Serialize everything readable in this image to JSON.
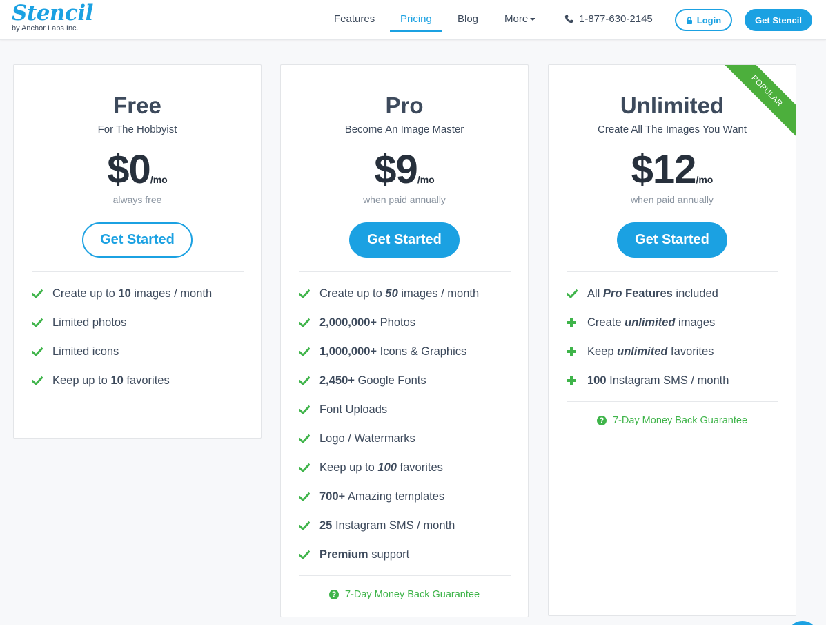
{
  "header": {
    "logo_word": "Stencil",
    "logo_sub": "by Anchor Labs Inc.",
    "nav": [
      {
        "label": "Features"
      },
      {
        "label": "Pricing",
        "active": true
      },
      {
        "label": "Blog"
      },
      {
        "label": "More"
      }
    ],
    "phone": "1-877-630-2145",
    "login_label": "Login",
    "cta_label": "Get Stencil"
  },
  "colors": {
    "accent": "#1ba1e2",
    "check": "#3fb44a",
    "ribbon": "#4caf3c",
    "text": "#3d4a5c"
  },
  "plans": [
    {
      "name": "Free",
      "tagline": "For The Hobbyist",
      "price": "$0",
      "period": "/mo",
      "note": "always free",
      "button": "Get Started",
      "features": [
        {
          "icon": "check-icon",
          "parts": [
            "Create up to ",
            "10",
            " images / month"
          ]
        },
        {
          "icon": "check-icon",
          "parts": [
            "Limited photos"
          ]
        },
        {
          "icon": "check-icon",
          "parts": [
            "Limited icons"
          ]
        },
        {
          "icon": "check-icon",
          "parts": [
            "Keep up to ",
            "10",
            " favorites"
          ]
        }
      ]
    },
    {
      "name": "Pro",
      "tagline": "Become An Image Master",
      "price": "$9",
      "period": "/mo",
      "note": "when paid annually",
      "button": "Get Started",
      "features": [
        {
          "icon": "check-icon",
          "parts": [
            "Create up to ",
            "50",
            " images / month"
          ]
        },
        {
          "icon": "check-icon",
          "parts": [
            "2,000,000+",
            " Photos"
          ]
        },
        {
          "icon": "check-icon",
          "parts": [
            "1,000,000+",
            " Icons & Graphics"
          ]
        },
        {
          "icon": "check-icon",
          "parts": [
            "2,450+",
            " Google Fonts"
          ]
        },
        {
          "icon": "check-icon",
          "parts": [
            "Font Uploads"
          ]
        },
        {
          "icon": "check-icon",
          "parts": [
            "Logo / Watermarks"
          ]
        },
        {
          "icon": "check-icon",
          "parts": [
            "Keep up to ",
            "100",
            " favorites"
          ]
        },
        {
          "icon": "check-icon",
          "parts": [
            "700+",
            " Amazing templates"
          ]
        },
        {
          "icon": "check-icon",
          "parts": [
            "25",
            " Instagram SMS / month"
          ]
        },
        {
          "icon": "check-icon",
          "parts": [
            "Premium",
            " support"
          ]
        }
      ],
      "guarantee": "7-Day Money Back Guarantee"
    },
    {
      "name": "Unlimited",
      "tagline": "Create All The Images You Want",
      "price": "$12",
      "period": "/mo",
      "note": "when paid annually",
      "button": "Get Started",
      "ribbon": "POPULAR",
      "features": [
        {
          "icon": "check-icon",
          "parts": [
            "All ",
            "Pro",
            " Features",
            " included"
          ]
        },
        {
          "icon": "plus-icon",
          "parts": [
            "Create ",
            "unlimited",
            " images"
          ]
        },
        {
          "icon": "plus-icon",
          "parts": [
            "Keep ",
            "unlimited",
            " favorites"
          ]
        },
        {
          "icon": "plus-icon",
          "parts": [
            "100",
            " Instagram SMS / month"
          ]
        }
      ],
      "guarantee": "7-Day Money Back Guarantee"
    }
  ]
}
